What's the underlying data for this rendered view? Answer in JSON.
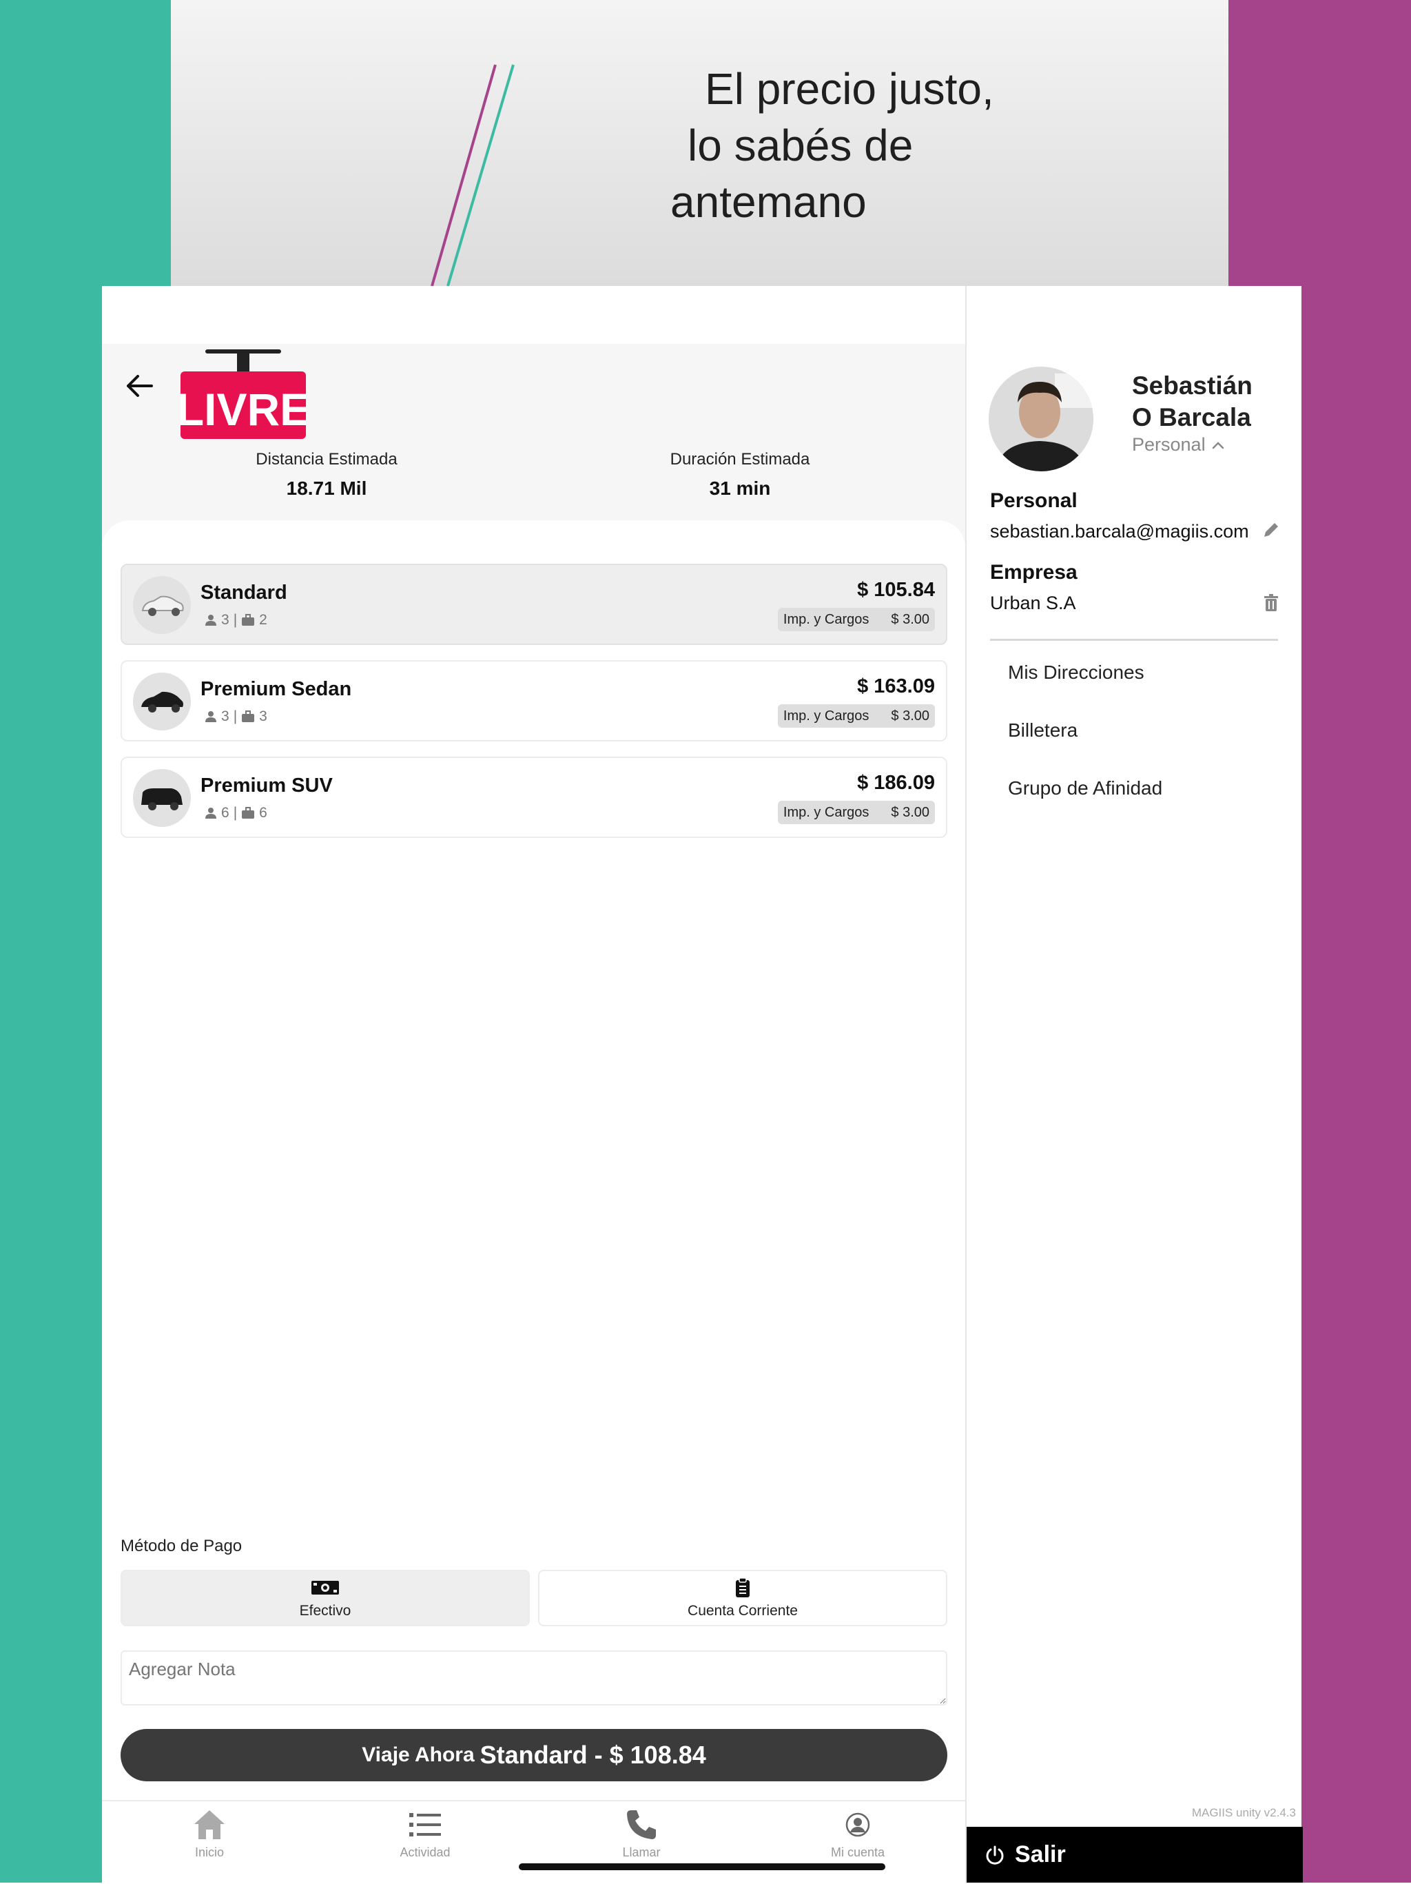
{
  "banner": {
    "line1": "El precio justo,",
    "line2": "lo sabés de",
    "line3": "antemano"
  },
  "header": {
    "logo_text": "LIVRE",
    "distance_label": "Distancia Estimada",
    "distance_value": "18.71 Mil",
    "duration_label": "Duración Estimada",
    "duration_value": "31 min"
  },
  "vehicles": [
    {
      "name": "Standard",
      "passengers": "3",
      "luggage": "2",
      "price": "$ 105.84",
      "fees_label": "Imp. y Cargos",
      "fees_value": "$ 3.00",
      "selected": true
    },
    {
      "name": "Premium Sedan",
      "passengers": "3",
      "luggage": "3",
      "price": "$ 163.09",
      "fees_label": "Imp. y Cargos",
      "fees_value": "$ 3.00",
      "selected": false
    },
    {
      "name": "Premium SUV",
      "passengers": "6",
      "luggage": "6",
      "price": "$ 186.09",
      "fees_label": "Imp. y Cargos",
      "fees_value": "$ 3.00",
      "selected": false
    }
  ],
  "payment": {
    "label": "Método de Pago",
    "options": [
      {
        "label": "Efectivo",
        "icon": "cash-icon",
        "selected": true
      },
      {
        "label": "Cuenta Corriente",
        "icon": "clipboard-icon",
        "selected": false
      }
    ]
  },
  "note": {
    "placeholder": "Agregar Nota"
  },
  "cta": {
    "prefix": "Viaje Ahora",
    "main": "Standard - $ 108.84"
  },
  "tabs": [
    {
      "label": "Inicio",
      "icon": "home-icon"
    },
    {
      "label": "Actividad",
      "icon": "list-icon"
    },
    {
      "label": "Llamar",
      "icon": "phone-icon"
    },
    {
      "label": "Mi cuenta",
      "icon": "account-icon"
    }
  ],
  "profile": {
    "name_line1": "Sebastián",
    "name_line2": "O Barcala",
    "account_type": "Personal",
    "personal_title": "Personal",
    "personal_email": "sebastian.barcala@magiis.com",
    "company_title": "Empresa",
    "company_name": "Urban S.A",
    "menu": [
      "Mis Direcciones",
      "Billetera",
      "Grupo de Afinidad"
    ],
    "version": "MAGIIS unity v2.4.3",
    "logout": "Salir"
  },
  "colors": {
    "teal": "#3DBBA2",
    "magenta": "#A5448A",
    "brand_red": "#E8114F",
    "button_dark": "#3B3B3B"
  }
}
